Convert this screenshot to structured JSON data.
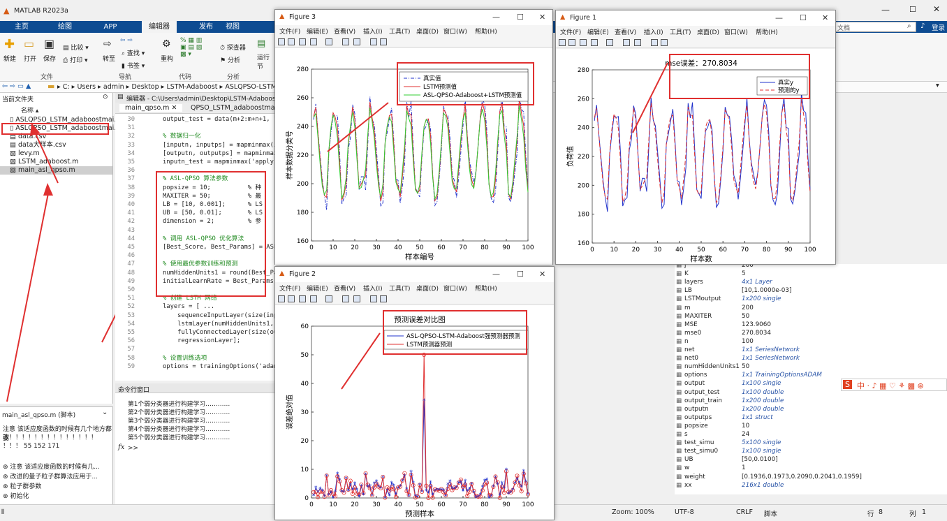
{
  "app": {
    "title": "MATLAB R2023a"
  },
  "tabs": [
    "主页",
    "绘图",
    "APP",
    "编辑器",
    "发布",
    "视图"
  ],
  "ribbon": {
    "new": "新建",
    "open": "打开",
    "save": "保存",
    "compare": "比较",
    "print": "打印",
    "goto": "转至",
    "find": "查找",
    "bookmark": "书签",
    "refactor": "重构",
    "profiler": "探查器",
    "analyze": "分析",
    "run_section": "运行节",
    "groups": [
      "文件",
      "导航",
      "代码",
      "分析"
    ],
    "search_placeholder": "文档",
    "login": "登录"
  },
  "address": {
    "path": [
      "C:",
      "Users",
      "admin",
      "Desktop",
      "LSTM-Adaboost",
      "ASLQPSO-LSTM"
    ]
  },
  "file_browser": {
    "header": "当前文件夹",
    "col": "名称",
    "files": [
      "ASLQPSO_LSTM_adaboostmai...",
      "ASLQPSO_LSTM_adaboostmai...",
      "data.csv",
      "data大样本.csv",
      "levy.m",
      "LSTM_adaboost.m",
      "main_asl_qpso.m"
    ]
  },
  "details": {
    "header": "main_asl_qpso.m (脚本)",
    "notes": [
      "注意 该适应度函数的时候有几个地方都要",
      "改！！！！！！！！！！！！！！",
      "！！！ 55 152 171"
    ],
    "outline": [
      "注意 该适应度函数的时候有几...",
      "改进的量子粒子群算法应用于...",
      "粒子群参数",
      "初始化"
    ]
  },
  "editor": {
    "header": "编辑器 - C:\\Users\\admin\\Desktop\\LSTM-Adaboost\\ASLQPSO-LSTM",
    "tabs": [
      "main_qpso.m",
      "QPSO_LSTM_adaboostmain"
    ],
    "lines": [
      {
        "n": "30",
        "t": "output_test = data(m+2:m+n+1, 1"
      },
      {
        "n": "31",
        "t": ""
      },
      {
        "n": "32",
        "t": "% 数据归一化",
        "c": 1
      },
      {
        "n": "33",
        "t": "[inputn, inputps] = mapminmax(i"
      },
      {
        "n": "34",
        "t": "[outputn, outputps] = mapminmax("
      },
      {
        "n": "35",
        "t": "inputn_test = mapminmax('apply'"
      },
      {
        "n": "36",
        "t": ""
      },
      {
        "n": "37",
        "t": "% ASL-QPSO 算法参数",
        "c": 1
      },
      {
        "n": "38",
        "t": "popsize = 10;          % 种"
      },
      {
        "n": "39",
        "t": "MAXITER = 50;          % 最"
      },
      {
        "n": "40",
        "t": "LB = [10, 0.001];      % LS"
      },
      {
        "n": "41",
        "t": "UB = [50, 0.01];       % LS"
      },
      {
        "n": "42",
        "t": "dimension = 2;         % 参"
      },
      {
        "n": "43",
        "t": ""
      },
      {
        "n": "44",
        "t": "% 调用 ASL-QPSO 优化算法",
        "c": 1
      },
      {
        "n": "45",
        "t": "[Best_Score, Best_Params] = ASL"
      },
      {
        "n": "46",
        "t": ""
      },
      {
        "n": "47",
        "t": "% 使用最优参数训练和预测",
        "c": 1
      },
      {
        "n": "48",
        "t": "numHiddenUnits1 = round(Best_Pa"
      },
      {
        "n": "49",
        "t": "initialLearnRate = Best_Params("
      },
      {
        "n": "50",
        "t": ""
      },
      {
        "n": "51",
        "t": "% 创建 LSTM 网络",
        "c": 1
      },
      {
        "n": "52",
        "t": "layers = [ ..."
      },
      {
        "n": "53",
        "t": "    sequenceInputLayer(size(inp"
      },
      {
        "n": "54",
        "t": "    lstmLayer(numHiddenUnits1,"
      },
      {
        "n": "55",
        "t": "    fullyConnectedLayer(size(ou"
      },
      {
        "n": "56",
        "t": "    regressionLayer];"
      },
      {
        "n": "57",
        "t": ""
      },
      {
        "n": "58",
        "t": "% 设置训练选项",
        "c": 1
      },
      {
        "n": "59",
        "t": "options = trainingOptions('adam"
      }
    ]
  },
  "command": {
    "header": "命令行窗口",
    "lines": [
      "第1个弱分类器进行构建学习…………",
      "第2个弱分类器进行构建学习…………",
      "第3个弱分类器进行构建学习…………",
      "第4个弱分类器进行构建学习…………",
      "第5个弱分类器进行构建学习…………"
    ],
    "prompt": ">>"
  },
  "workspace": [
    {
      "n": "j",
      "v": "200"
    },
    {
      "n": "K",
      "v": "5"
    },
    {
      "n": "layers",
      "v": "4x1 Layer",
      "i": 1
    },
    {
      "n": "LB",
      "v": "[10,1.0000e-03]"
    },
    {
      "n": "LSTMoutput",
      "v": "1x200 single",
      "i": 1
    },
    {
      "n": "m",
      "v": "200"
    },
    {
      "n": "MAXITER",
      "v": "50"
    },
    {
      "n": "MSE",
      "v": "123.9060"
    },
    {
      "n": "mse0",
      "v": "270.8034"
    },
    {
      "n": "n",
      "v": "100"
    },
    {
      "n": "net",
      "v": "1x1 SeriesNetwork",
      "i": 1
    },
    {
      "n": "net0",
      "v": "1x1 SeriesNetwork",
      "i": 1
    },
    {
      "n": "numHiddenUnits1",
      "v": "50"
    },
    {
      "n": "options",
      "v": "1x1 TrainingOptionsADAM",
      "i": 1
    },
    {
      "n": "output",
      "v": "1x100 single",
      "i": 1
    },
    {
      "n": "output_test",
      "v": "1x100 double",
      "i": 1
    },
    {
      "n": "output_train",
      "v": "1x200 double",
      "i": 1
    },
    {
      "n": "outputn",
      "v": "1x200 double",
      "i": 1
    },
    {
      "n": "outputps",
      "v": "1x1 struct",
      "i": 1
    },
    {
      "n": "popsize",
      "v": "10"
    },
    {
      "n": "s",
      "v": "24"
    },
    {
      "n": "test_simu",
      "v": "5x100 single",
      "i": 1
    },
    {
      "n": "test_simu0",
      "v": "1x100 single",
      "i": 1
    },
    {
      "n": "UB",
      "v": "[50,0.0100]"
    },
    {
      "n": "w",
      "v": "1"
    },
    {
      "n": "weight",
      "v": "[0.1936,0.1973,0.2090,0.2041,0.1959]"
    },
    {
      "n": "xx",
      "v": "216x1 double",
      "i": 1
    }
  ],
  "status": {
    "zoom": "Zoom: 100%",
    "enc": "UTF-8",
    "eol": "CRLF",
    "type": "脚本",
    "row_label": "行",
    "row": "8",
    "col_label": "列",
    "col": "1"
  },
  "fig_menu": [
    "文件(F)",
    "编辑(E)",
    "查看(V)",
    "插入(I)",
    "工具(T)",
    "桌面(D)",
    "窗口(W)",
    "帮助(H)"
  ],
  "figures": {
    "fig3": {
      "title": "Figure 3"
    },
    "fig1": {
      "title": "Figure 1"
    },
    "fig2": {
      "title": "Figure 2"
    }
  },
  "chart_data": [
    {
      "type": "line",
      "figure": "Figure 3",
      "xlabel": "样本编号",
      "ylabel": "样本数据分类号",
      "ylim": [
        160,
        280
      ],
      "xlim": [
        0,
        100
      ],
      "xticks": [
        0,
        10,
        20,
        30,
        40,
        50,
        60,
        70,
        80,
        90,
        100
      ],
      "yticks": [
        160,
        180,
        200,
        220,
        240,
        260,
        280
      ],
      "series": [
        {
          "name": "真实值",
          "color": "#2233cc",
          "style": "dashdot"
        },
        {
          "name": "LSTM预测值",
          "color": "#e03030",
          "style": "solid"
        },
        {
          "name": "ASL-QPSO-Adaboost+LSTM预测值",
          "color": "#33cc33",
          "style": "solid"
        }
      ]
    },
    {
      "type": "line",
      "figure": "Figure 1",
      "title": "mse误差：270.8034",
      "ylabel": "负荷值",
      "xlabel": "样本数",
      "ylim": [
        160,
        280
      ],
      "xlim": [
        0,
        100
      ],
      "xticks": [
        0,
        10,
        20,
        30,
        40,
        50,
        60,
        70,
        80,
        90,
        100
      ],
      "yticks": [
        160,
        180,
        200,
        220,
        240,
        260,
        280
      ],
      "series": [
        {
          "name": "真实y",
          "color": "#2233cc",
          "style": "solid"
        },
        {
          "name": "预测的y",
          "color": "#e03030",
          "style": "dashed"
        }
      ]
    },
    {
      "type": "line",
      "figure": "Figure 2",
      "title": "预测误差对比图",
      "xlabel": "预测样本",
      "ylabel": "误差绝对值",
      "ylim": [
        0,
        60
      ],
      "xlim": [
        0,
        100
      ],
      "xticks": [
        0,
        10,
        20,
        30,
        40,
        50,
        60,
        70,
        80,
        90,
        100
      ],
      "yticks": [
        0,
        10,
        20,
        30,
        40,
        50,
        60
      ],
      "series": [
        {
          "name": "ASL-QPSO-LSTM-Adaboost强预测器预测",
          "color": "#2233cc",
          "marker": "*"
        },
        {
          "name": "LSTM预测器预测",
          "color": "#e03030",
          "marker": "o"
        }
      ]
    }
  ]
}
